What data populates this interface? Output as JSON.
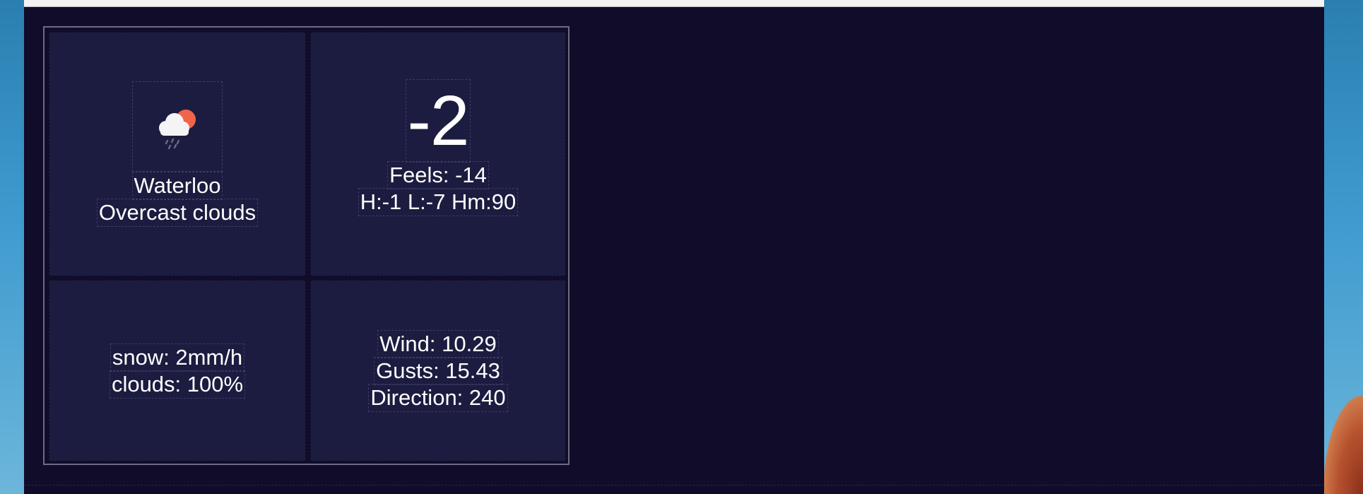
{
  "location_tile": {
    "icon": "cloud-sun-rain-icon",
    "city": "Waterloo",
    "condition": "Overcast clouds"
  },
  "temperature_tile": {
    "current": "-2",
    "feels": "Feels: -14",
    "range": "H:-1 L:-7 Hm:90"
  },
  "precip_tile": {
    "snow": "snow: 2mm/h",
    "clouds": "clouds: 100%"
  },
  "wind_tile": {
    "wind": "Wind: 10.29",
    "gusts": "Gusts: 15.43",
    "direction": "Direction: 240"
  },
  "colors": {
    "background": "#100c2a",
    "tile": "#1c1c40",
    "sun": "#f0644a",
    "text": "#ffffff"
  }
}
